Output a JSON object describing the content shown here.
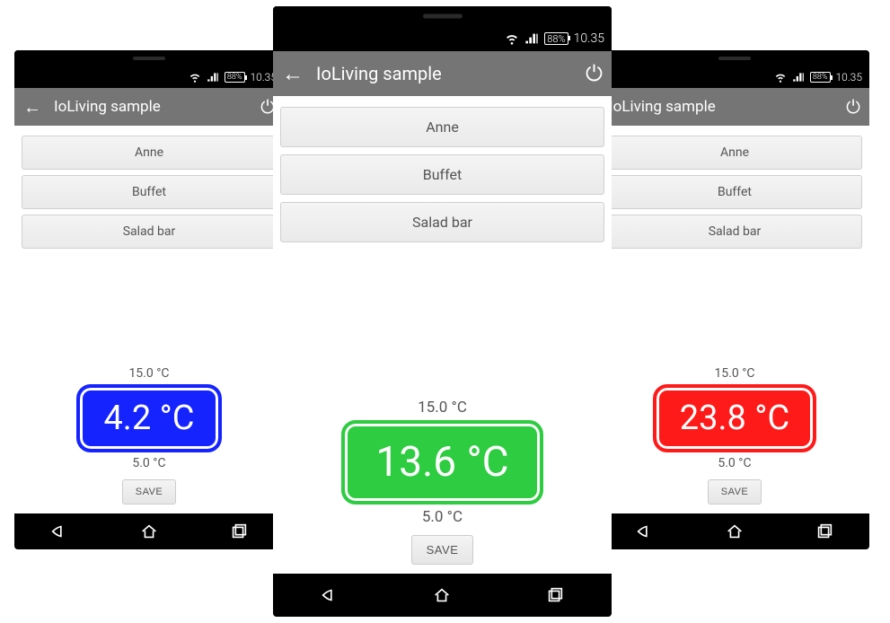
{
  "status": {
    "battery": "88%",
    "time": "10.35"
  },
  "appbar": {
    "title": "IoLiving sample"
  },
  "buttons": {
    "item0": "Anne",
    "item1": "Buffet",
    "item2": "Salad bar",
    "save": "SAVE"
  },
  "limits": {
    "upper": "15.0 °C",
    "lower": "5.0 °C"
  },
  "screens": [
    {
      "temp": "4.2 °C",
      "color": "#1423ff"
    },
    {
      "temp": "13.6 °C",
      "color": "#2ecc40"
    },
    {
      "temp": "23.8 °C",
      "color": "#ff1a1a"
    }
  ],
  "icons": {
    "back": "←",
    "power": "⏻"
  }
}
